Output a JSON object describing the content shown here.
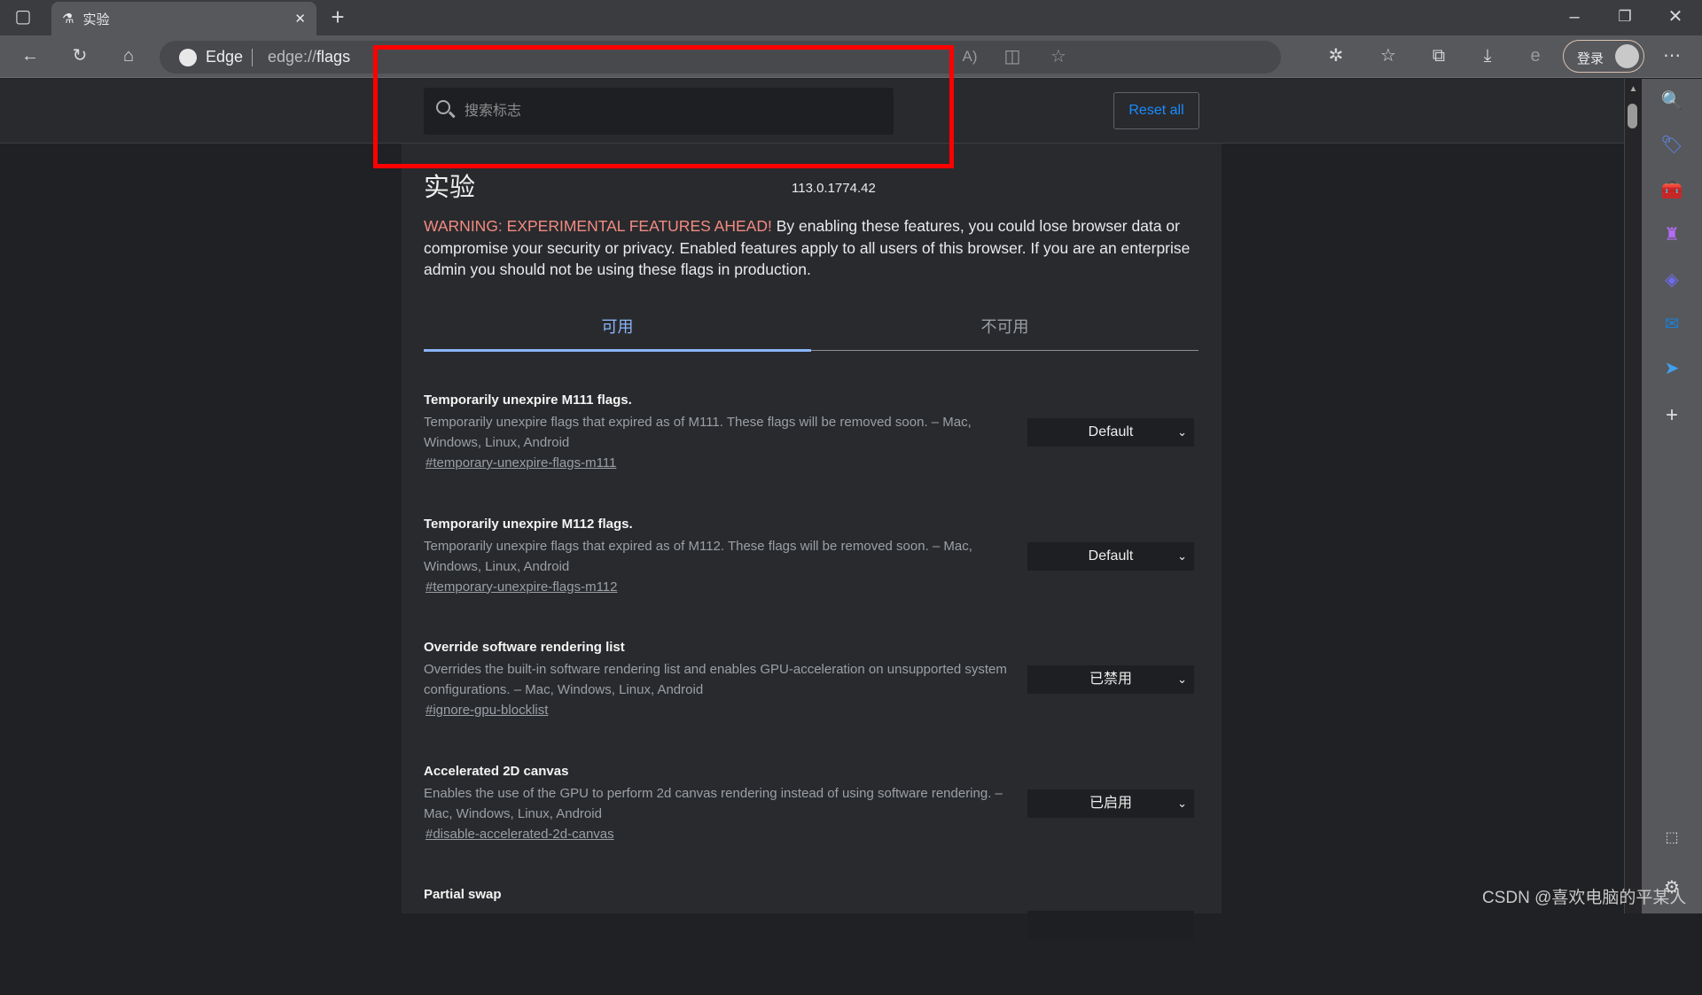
{
  "browser": {
    "tab": {
      "title": "实验",
      "icon": "flask-icon"
    },
    "address": {
      "brand": "Edge",
      "url_prefix": "edge://",
      "url_path": "flags"
    },
    "login_label": "登录"
  },
  "page": {
    "search_placeholder": "搜索标志",
    "reset_label": "Reset all",
    "title": "实验",
    "version": "113.0.1774.42",
    "warning_strong": "WARNING: EXPERIMENTAL FEATURES AHEAD!",
    "warning_text": " By enabling these features, you could lose browser data or compromise your security or privacy. Enabled features apply to all users of this browser. If you are an enterprise admin you should not be using these flags in production.",
    "tabs": [
      {
        "label": "可用",
        "active": true
      },
      {
        "label": "不可用",
        "active": false
      }
    ],
    "flags": [
      {
        "title": "Temporarily unexpire M111 flags.",
        "desc": "Temporarily unexpire flags that expired as of M111. These flags will be removed soon. – Mac, Windows, Linux, Android",
        "link": "#temporary-unexpire-flags-m111",
        "value": "Default"
      },
      {
        "title": "Temporarily unexpire M112 flags.",
        "desc": "Temporarily unexpire flags that expired as of M112. These flags will be removed soon. – Mac, Windows, Linux, Android",
        "link": "#temporary-unexpire-flags-m112",
        "value": "Default"
      },
      {
        "title": "Override software rendering list",
        "desc": "Overrides the built-in software rendering list and enables GPU-acceleration on unsupported system configurations. – Mac, Windows, Linux, Android",
        "link": "#ignore-gpu-blocklist",
        "value": "已禁用"
      },
      {
        "title": "Accelerated 2D canvas",
        "desc": "Enables the use of the GPU to perform 2d canvas rendering instead of using software rendering. – Mac, Windows, Linux, Android",
        "link": "#disable-accelerated-2d-canvas",
        "value": "已启用"
      },
      {
        "title": "Partial swap",
        "desc": "",
        "link": "",
        "value": ""
      }
    ]
  },
  "watermark": "CSDN @喜欢电脑的平某人",
  "colors": {
    "warning": "#f28b82",
    "accent": "#8ab4f8",
    "reset": "#1a8cff",
    "highlight": "#ff0000"
  }
}
